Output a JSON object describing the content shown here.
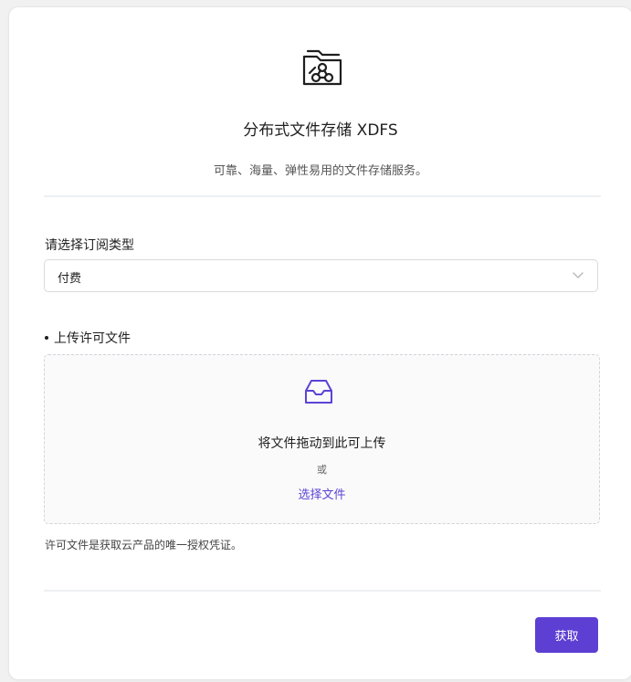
{
  "header": {
    "icon": "folder-share-icon",
    "title": "分布式文件存储 XDFS",
    "subtitle": "可靠、海量、弹性易用的文件存储服务。"
  },
  "subscription": {
    "label": "请选择订阅类型",
    "selected": "付费",
    "chevron_icon": "chevron-down-icon"
  },
  "upload": {
    "label": "上传许可文件",
    "required": true,
    "icon": "inbox-icon",
    "drop_text": "将文件拖动到此可上传",
    "or_text": "或",
    "choose_link": "选择文件",
    "hint": "许可文件是获取云产品的唯一授权凭证。"
  },
  "actions": {
    "submit_label": "获取"
  },
  "colors": {
    "accent": "#5d3fd3",
    "link": "#5b43d6",
    "border": "#d7d9dd"
  }
}
